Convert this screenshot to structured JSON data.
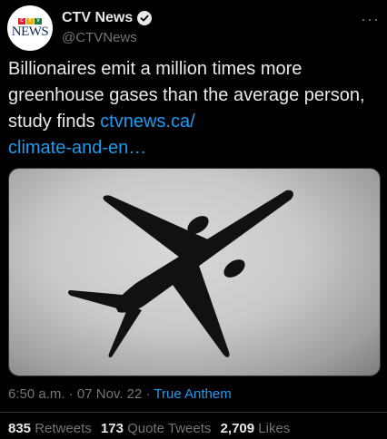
{
  "author": {
    "display_name": "CTV News",
    "handle": "@CTVNews",
    "verified": true,
    "avatar_logo_text": "NEWS",
    "avatar_logo_mark": "CTV",
    "avatar_colors": {
      "news": "#0c2a55",
      "c": "#d4202b",
      "t": "#f2a900",
      "v": "#1f7a3d"
    }
  },
  "more_icon": "more-horizontal-icon",
  "tweet": {
    "text": "Billionaires emit a million times more greenhouse gases than the average person, study finds ",
    "link_text": "ctvnews.ca/\nclimate-and-en…",
    "link_color": "#1d9bf0"
  },
  "media": {
    "description_icon": "airplane-silhouette"
  },
  "meta": {
    "time": "6:50 a.m.",
    "separator": "·",
    "date": "07 Nov. 22",
    "source": "True Anthem"
  },
  "stats": {
    "retweets_count": "835",
    "retweets_label": "Retweets",
    "quote_count": "173",
    "quote_label": "Quote Tweets",
    "likes_count": "2,709",
    "likes_label": "Likes"
  }
}
